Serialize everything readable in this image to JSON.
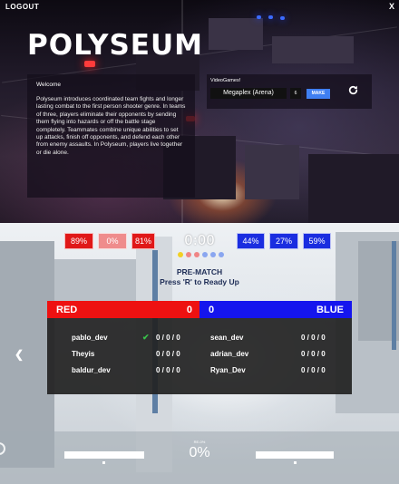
{
  "lobby": {
    "logout_label": "LOGOUT",
    "close_label": "X",
    "title": "POLYSEUM",
    "welcome_heading": "Welcome",
    "welcome_body": "Polyseum introduces coordinated team fights and longer lasting combat to the first person shooter genre. In teams of three, players eliminate their opponents by sending them flying into hazards or off the battle stage completely. Teammates combine unique abilities to set up attacks, finish off opponents, and defend each other from enemy assaults. In Polyseum, players live together or die alone.",
    "server_heading": "VideoGames!",
    "arena_value": "Megaplex (Arena)",
    "player_count": "6",
    "make_label": "MAKE",
    "refresh_icon": "refresh-icon"
  },
  "hud": {
    "red_scores": [
      "89%",
      "0%",
      "81%"
    ],
    "blue_scores": [
      "44%",
      "27%",
      "59%"
    ],
    "timer": "0:00",
    "dot_colors": [
      "#f2d024",
      "#f08585",
      "#f08585",
      "#8aa6f0",
      "#8aa6f0",
      "#8aa6f0"
    ],
    "status_title": "PRE-MATCH",
    "status_prompt": "Press 'R' to Ready Up",
    "center_small": "RE-0%",
    "center_percent": "0%"
  },
  "scoreboard": {
    "red_label": "RED",
    "red_score": "0",
    "blue_label": "BLUE",
    "blue_score": "0",
    "red_players": [
      {
        "name": "pablo_dev",
        "ready": "✔",
        "kda": "0 / 0 / 0"
      },
      {
        "name": "Theyis",
        "ready": "",
        "kda": "0 / 0 / 0"
      },
      {
        "name": "baldur_dev",
        "ready": "",
        "kda": "0 / 0 / 0"
      }
    ],
    "blue_players": [
      {
        "name": "sean_dev",
        "kda": "0 / 0 / 0"
      },
      {
        "name": "adrian_dev",
        "kda": "0 / 0 / 0"
      },
      {
        "name": "Ryan_Dev",
        "kda": "0 / 0 / 0"
      }
    ]
  },
  "colors": {
    "team_red": "#ee1111",
    "team_blue": "#1515ee",
    "make_button": "#3f7ff2",
    "ready_check": "#39c24a"
  }
}
